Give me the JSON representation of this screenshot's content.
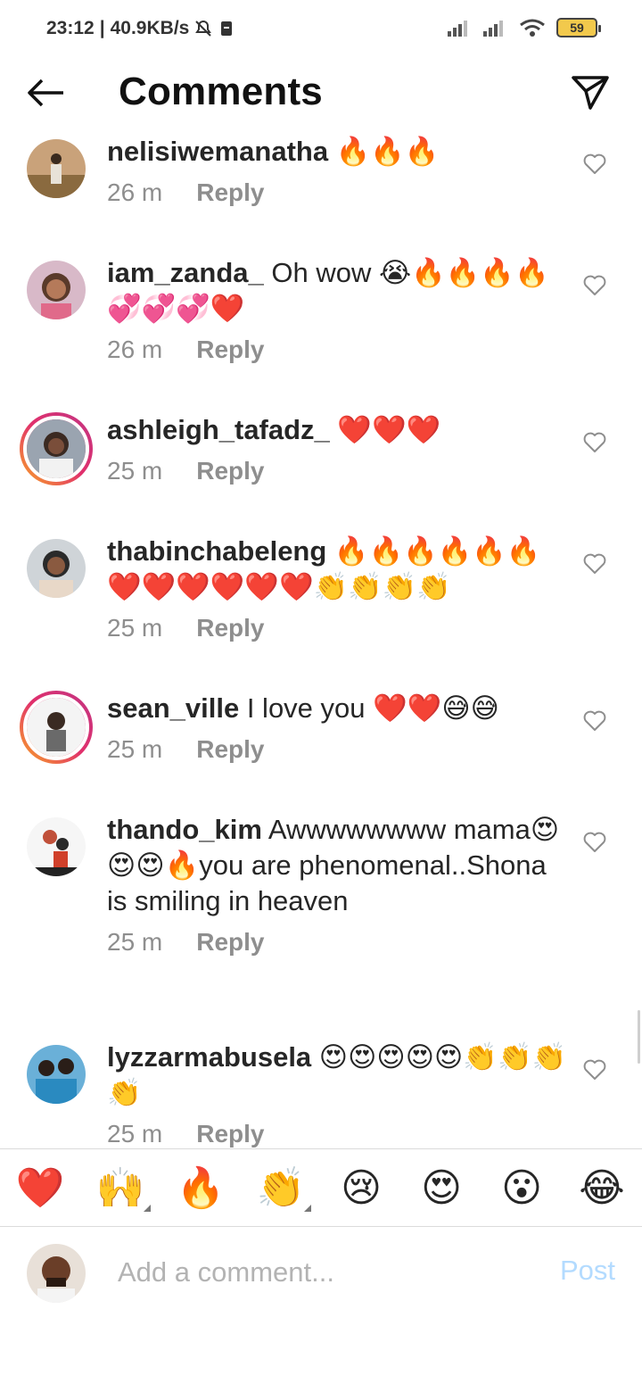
{
  "status_bar": {
    "time": "23:12",
    "network_speed": "40.9KB/s",
    "battery": "59",
    "icons": [
      "mute-icon",
      "sim-icon",
      "signal-icon",
      "signal-icon",
      "wifi-icon",
      "battery-icon"
    ]
  },
  "header": {
    "title": "Comments",
    "back_icon": "arrow-left-icon",
    "share_icon": "paper-plane-icon"
  },
  "comments": [
    {
      "username": "nelisiwemanatha",
      "text": " 🔥🔥🔥",
      "time": "26 m",
      "reply": "Reply"
    },
    {
      "username": "iam_zanda_",
      "text": " Oh wow 😭🔥🔥🔥🔥💞💞💞❤️",
      "time": "26 m",
      "reply": "Reply"
    },
    {
      "username": "ashleigh_tafadz_",
      "text": " ❤️❤️❤️",
      "time": "25 m",
      "reply": "Reply"
    },
    {
      "username": "thabinchabeleng",
      "text": " 🔥🔥🔥🔥🔥🔥❤️❤️❤️❤️❤️❤️👏👏👏👏",
      "time": "25 m",
      "reply": "Reply"
    },
    {
      "username": "sean_ville",
      "text": " I love you ❤️❤️😅😅",
      "time": "25 m",
      "reply": "Reply"
    },
    {
      "username": "thando_kim",
      "text": " Awwwwwwww mama😍😍😍🔥you are phenomenal..Shona is smiling in heaven",
      "time": "25 m",
      "reply": "Reply"
    },
    {
      "username": "lyzzarmabusela",
      "text": " 😍😍😍😍😍👏👏👏👏",
      "time": "25 m",
      "reply": "Reply"
    }
  ],
  "quick_reactions": [
    "❤️",
    "🙌",
    "🔥",
    "👏",
    "😢",
    "😍",
    "😮",
    "😂"
  ],
  "composer": {
    "placeholder": "Add a comment...",
    "post_label": "Post"
  },
  "colors": {
    "link_blue_disabled": "#b3dbff",
    "muted_text": "#8e8e8e",
    "story_ring_start": "#f9a825",
    "story_ring_end": "#c13584"
  }
}
